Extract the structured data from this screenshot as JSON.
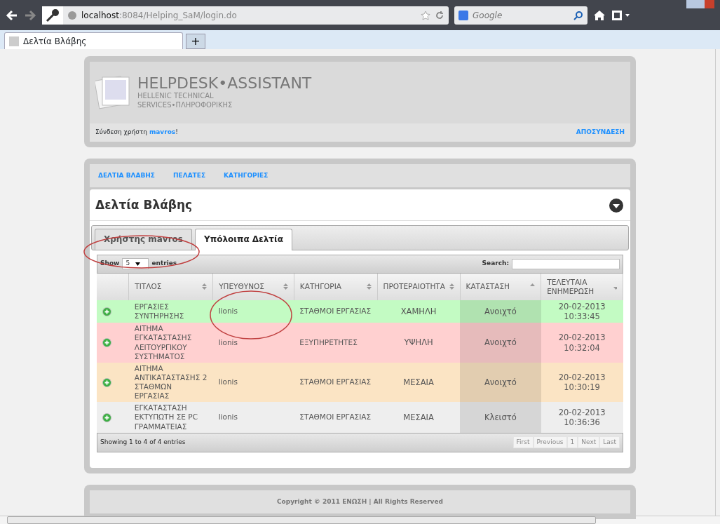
{
  "browser": {
    "address_host": "localhost",
    "address_path": ":8084/Helping_SaM/login.do",
    "search_placeholder": "Google",
    "tab_title": "Δελτία Βλάβης",
    "new_tab": "+"
  },
  "header": {
    "title": "HELPDESK•ASSISTANT",
    "subtitle_1": "HELLENIC TECHNICAL",
    "subtitle_2": "SERVICES•ΠΛΗΡΟΦΟΡΙΚΗΣ",
    "login_prefix": "Σύνδεση χρήστη ",
    "username": "mavros",
    "login_suffix": "!",
    "logout": "ΑΠΟΣΥΝΔΕΣΗ"
  },
  "nav": [
    {
      "label": "ΔΕΛΤΙΑ ΒΛΑΒΗΣ"
    },
    {
      "label": "ΠΕΛΑΤΕΣ"
    },
    {
      "label": "ΚΑΤΗΓΟΡΙΕΣ"
    }
  ],
  "panel": {
    "title": "Δελτία Βλάβης"
  },
  "tabs": [
    {
      "label": "Χρήστης mavros",
      "selected": false
    },
    {
      "label": "Υπόλοιπα Δελτία",
      "selected": true
    }
  ],
  "table": {
    "show_label": "Show",
    "page_size": "5",
    "entries_label": "entries",
    "search_label": "Search:",
    "columns": [
      {
        "label": "ΤΙΤΛΟΣ",
        "sort_up": true,
        "sort_down": true
      },
      {
        "label": "ΥΠΕΥΘΥΝΟΣ",
        "sort_up": true,
        "sort_down": true
      },
      {
        "label": "ΚΑΤΗΓΟΡΙΑ",
        "sort_up": true,
        "sort_down": true
      },
      {
        "label": "ΠΡΟΤΕΡΑΙΟΤΗΤΑ",
        "sort_up": true,
        "sort_down": true
      },
      {
        "label": "ΚΑΤΑΣΤΑΣΗ",
        "sort_up": true,
        "sort_down": false
      },
      {
        "label": "ΤΕΛΕΥΤΑΙΑ ΕΝΗΜΕΡΩΣΗ",
        "sort_up": false,
        "sort_down": true
      }
    ],
    "rows": [
      {
        "color": "#c3fbc3",
        "cells": [
          "ΕΡΓΑΣΙΕΣ ΣΥΝΤΗΡΗΣΗΣ",
          "lionis",
          "ΣΤΑΘΜΟΙ ΕΡΓΑΣΙΑΣ",
          "ΧΑΜΗΛΗ",
          "Ανοιχτό",
          "20-02-2013 10:33:45"
        ]
      },
      {
        "color": "#ffd0d0",
        "cells": [
          "ΑΙΤΗΜΑ ΕΓΚΑΤΑΣΤΑΣΗΣ ΛΕΙΤΟΥΡΓΙΚΟΥ ΣΥΣΤΗΜΑΤΟΣ",
          "lionis",
          "ΕΞΥΠΗΡΕΤΗΤΕΣ",
          "ΥΨΗΛΗ",
          "Ανοιχτό",
          "20-02-2013 10:32:04"
        ]
      },
      {
        "color": "#fbe4c4",
        "cells": [
          "ΑΙΤΗΜΑ ΑΝΤΙΚΑΤΑΣΤΑΣΗΣ 2 ΣΤΑΘΜΩΝ ΕΡΓΑΣΙΑΣ",
          "lionis",
          "ΣΤΑΘΜΟΙ ΕΡΓΑΣΙΑΣ",
          "ΜΕΣΑΙΑ",
          "Ανοιχτό",
          "20-02-2013 10:30:19"
        ]
      },
      {
        "color": "#eeeeee",
        "cells": [
          "ΕΓΚΑΤΑΣΤΑΣΗ ΕΚΤΥΠΩΤΗ ΣΕ PC ΓΡΑΜΜΑΤΕΙΑΣ",
          "lionis",
          "ΣΤΑΘΜΟΙ ΕΡΓΑΣΙΑΣ",
          "ΜΕΣΑΙΑ",
          "Κλειστό",
          "20-02-2013 10:36:36"
        ]
      }
    ],
    "info": "Showing 1 to 4 of 4 entries",
    "pagination": [
      {
        "label": "First",
        "disabled": true
      },
      {
        "label": "Previous",
        "disabled": true
      },
      {
        "label": "1",
        "disabled": true
      },
      {
        "label": "Next",
        "disabled": true
      },
      {
        "label": "Last",
        "disabled": true
      }
    ]
  },
  "footer": "Copyright © 2011 ΕΝΩΣΗ   |  All Rights Reserved"
}
